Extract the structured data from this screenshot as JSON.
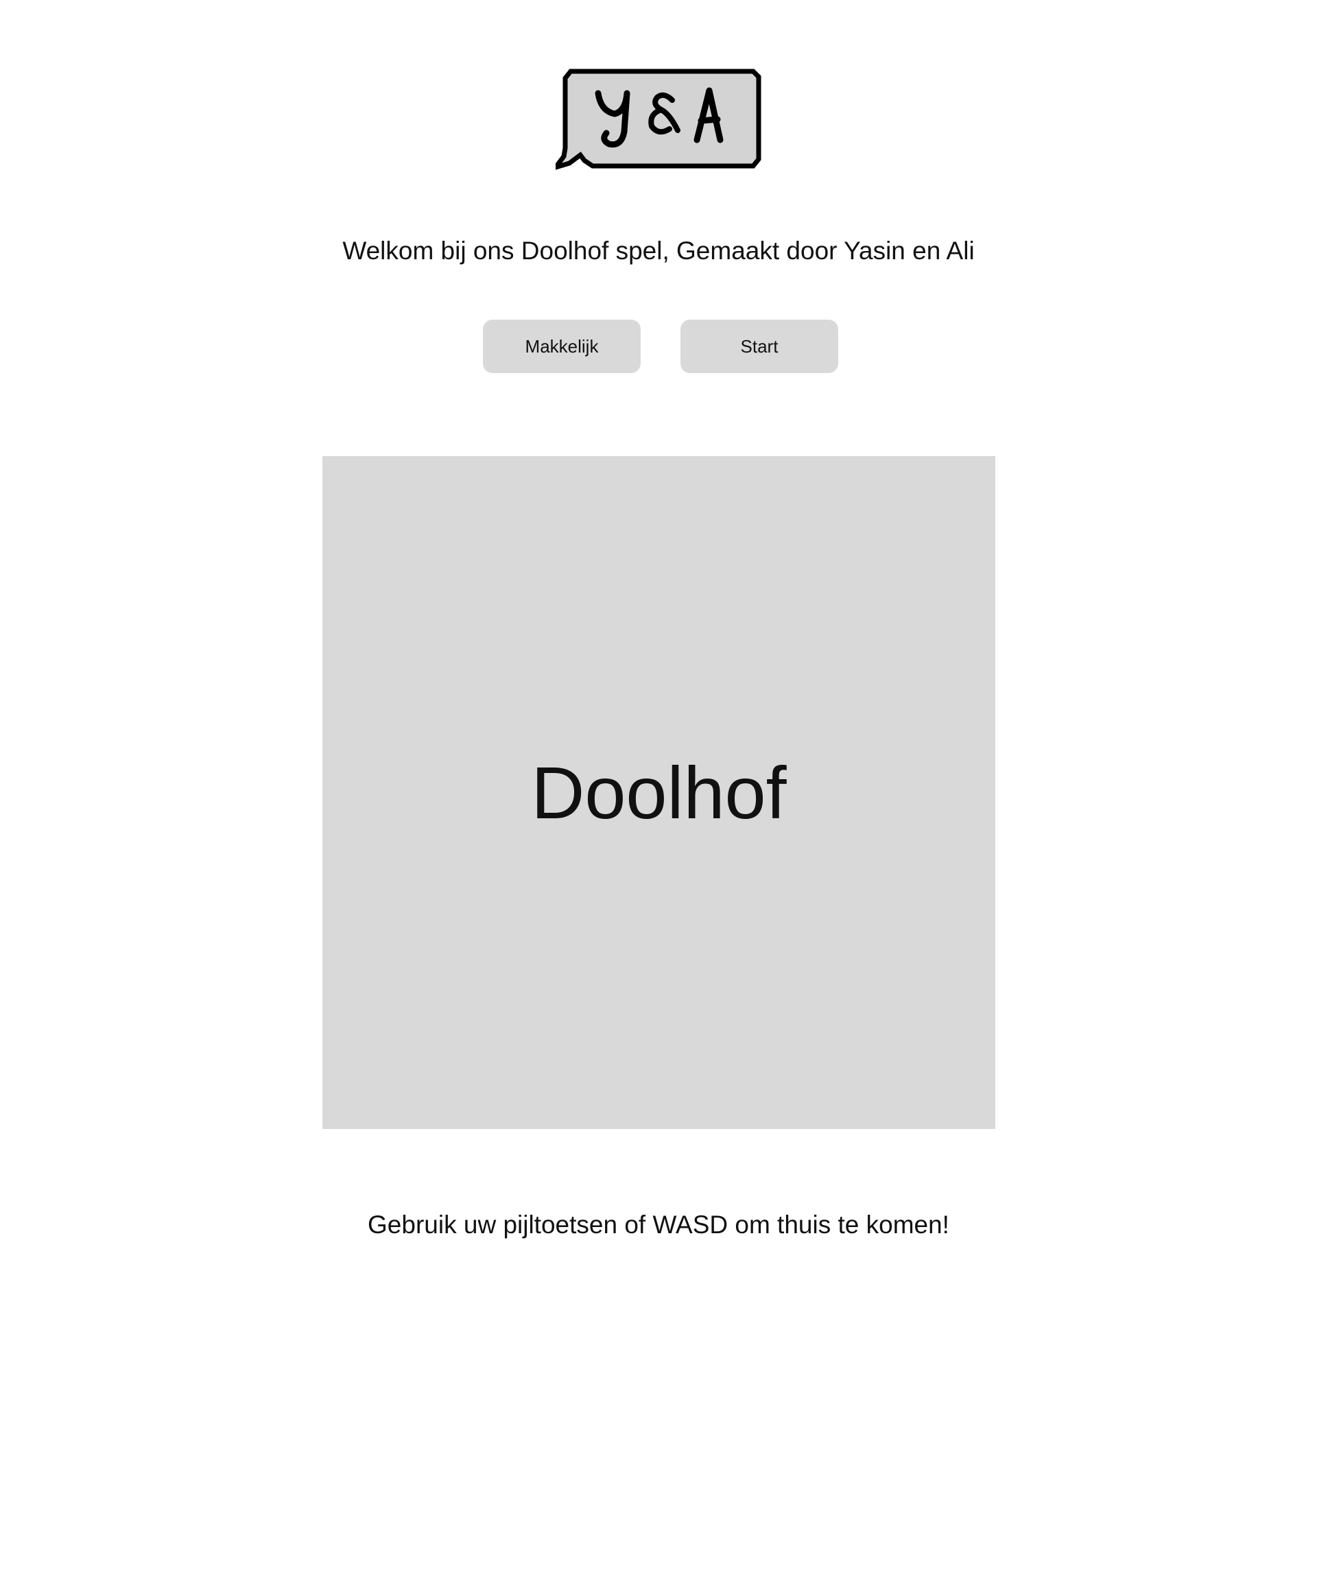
{
  "logo": {
    "text": "Y&A"
  },
  "welcome_text": "Welkom bij ons Doolhof spel, Gemaakt door Yasin en Ali",
  "buttons": {
    "difficulty_label": "Makkelijk",
    "start_label": "Start"
  },
  "maze": {
    "title": "Doolhof"
  },
  "instructions_text": "Gebruik uw pijltoetsen of WASD om thuis te komen!",
  "colors": {
    "background": "#ffffff",
    "panel": "#d9d9d9",
    "text": "#111111"
  }
}
